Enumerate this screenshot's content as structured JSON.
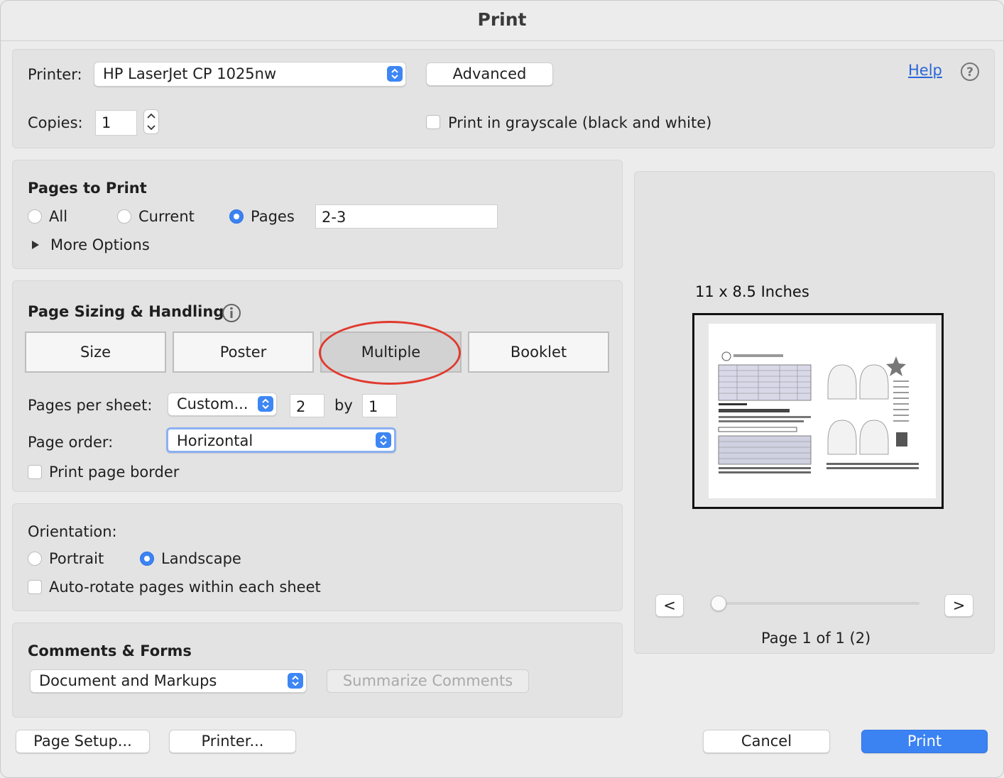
{
  "window": {
    "title": "Print"
  },
  "printer": {
    "label": "Printer:",
    "selected": "HP LaserJet CP 1025nw",
    "advanced_label": "Advanced",
    "help_label": "Help",
    "copies_label": "Copies:",
    "copies_value": "1",
    "grayscale_label": "Print in grayscale (black and white)",
    "grayscale_checked": false
  },
  "pages_to_print": {
    "title": "Pages to Print",
    "options": [
      "All",
      "Current",
      "Pages"
    ],
    "selected": "Pages",
    "pages_value": "2-3",
    "more_options_label": "More Options"
  },
  "sizing": {
    "title": "Page Sizing & Handling",
    "tabs": [
      "Size",
      "Poster",
      "Multiple",
      "Booklet"
    ],
    "selected_tab": "Multiple",
    "pages_per_sheet_label": "Pages per sheet:",
    "pages_per_sheet_value": "Custom...",
    "cols": "2",
    "by_label": "by",
    "rows": "1",
    "page_order_label": "Page order:",
    "page_order_value": "Horizontal",
    "border_label": "Print page border",
    "border_checked": false
  },
  "orientation": {
    "title": "Orientation:",
    "portrait_label": "Portrait",
    "landscape_label": "Landscape",
    "selected": "Landscape",
    "autorotate_label": "Auto-rotate pages within each sheet",
    "autorotate_checked": false
  },
  "comments": {
    "title": "Comments & Forms",
    "selected": "Document and Markups",
    "summarize_label": "Summarize Comments"
  },
  "preview": {
    "size_label": "11 x 8.5 Inches",
    "prev_label": "<",
    "next_label": ">",
    "page_label": "Page 1 of 1 (2)",
    "slider_position": 0
  },
  "footer": {
    "page_setup_label": "Page Setup...",
    "printer_label": "Printer...",
    "cancel_label": "Cancel",
    "print_label": "Print"
  },
  "colors": {
    "accent": "#3b82f3",
    "annotation": "#e03a2f",
    "link": "#2a66d6"
  }
}
